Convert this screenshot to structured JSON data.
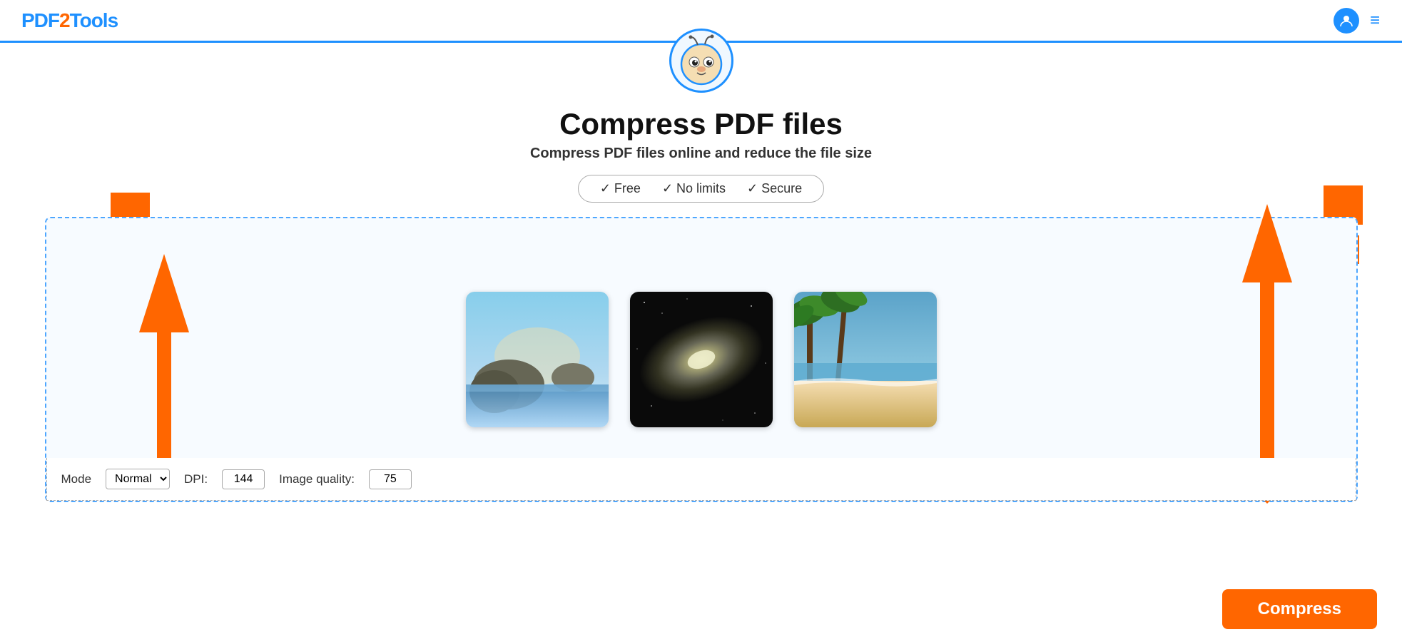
{
  "header": {
    "logo": "PDF2Tools",
    "logo_accent": "2"
  },
  "page": {
    "title": "Compress PDF files",
    "subtitle": "Compress PDF files online and reduce the file size",
    "features": [
      "✓ Free",
      "✓ No limits",
      "✓ Secure"
    ]
  },
  "thumbnails": [
    {
      "id": "thumb1",
      "alt": "Ocean sunset scene",
      "class": "thumb1"
    },
    {
      "id": "thumb2",
      "alt": "Galaxy space",
      "class": "thumb2"
    },
    {
      "id": "thumb3",
      "alt": "Tropical beach",
      "class": "thumb3"
    }
  ],
  "settings": {
    "mode_label": "Mode",
    "mode_value": "Normal",
    "dpi_label": "DPI:",
    "dpi_value": "144",
    "quality_label": "Image quality:",
    "quality_value": "75"
  },
  "buttons": {
    "compress_label": "Compress"
  },
  "icons": {
    "security": "✓",
    "dropbox": "⬡",
    "gdrive": "▲"
  }
}
